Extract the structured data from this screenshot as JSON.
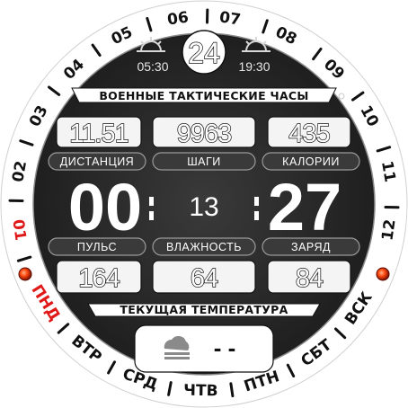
{
  "ring": {
    "hours": [
      "01",
      "02",
      "03",
      "04",
      "05",
      "06",
      "07",
      "08",
      "09",
      "10",
      "11",
      "12"
    ],
    "active_hour": "01",
    "weekdays": [
      "ПНД",
      "ВТР",
      "СРД",
      "ЧТВ",
      "ПТН",
      "СБТ",
      "ВСК"
    ],
    "active_weekday": "ПНД"
  },
  "top": {
    "date": "24",
    "sunrise": "05:30",
    "sunset": "19:30"
  },
  "title": "ВОЕННЫЕ ТАКТИЧЕСКИЕ ЧАСЫ",
  "stats_top": [
    {
      "value": "11.51",
      "label": "ДИСТАНЦИЯ"
    },
    {
      "value": "9963",
      "label": "ШАГИ"
    },
    {
      "value": "435",
      "label": "КАЛОРИИ"
    }
  ],
  "time": {
    "hours": "00",
    "seconds": "13",
    "minutes": "27"
  },
  "stats_bottom": [
    {
      "value": "164",
      "label": "ПУЛЬС"
    },
    {
      "value": "64",
      "label": "ВЛАЖНОСТЬ"
    },
    {
      "value": "84",
      "label": "ЗАРЯД"
    }
  ],
  "temperature": {
    "label": "ТЕКУЩАЯ ТЕМПЕРАТУРА",
    "value": "- -"
  },
  "icons": {
    "sunrise": "sunrise-icon",
    "sunset": "sunset-icon",
    "weather": "cloud-snow-icon",
    "indicator": "red-led-icon"
  },
  "colors": {
    "accent": "#e01818",
    "face": "#2b2b2b",
    "ring": "#ffffff"
  }
}
